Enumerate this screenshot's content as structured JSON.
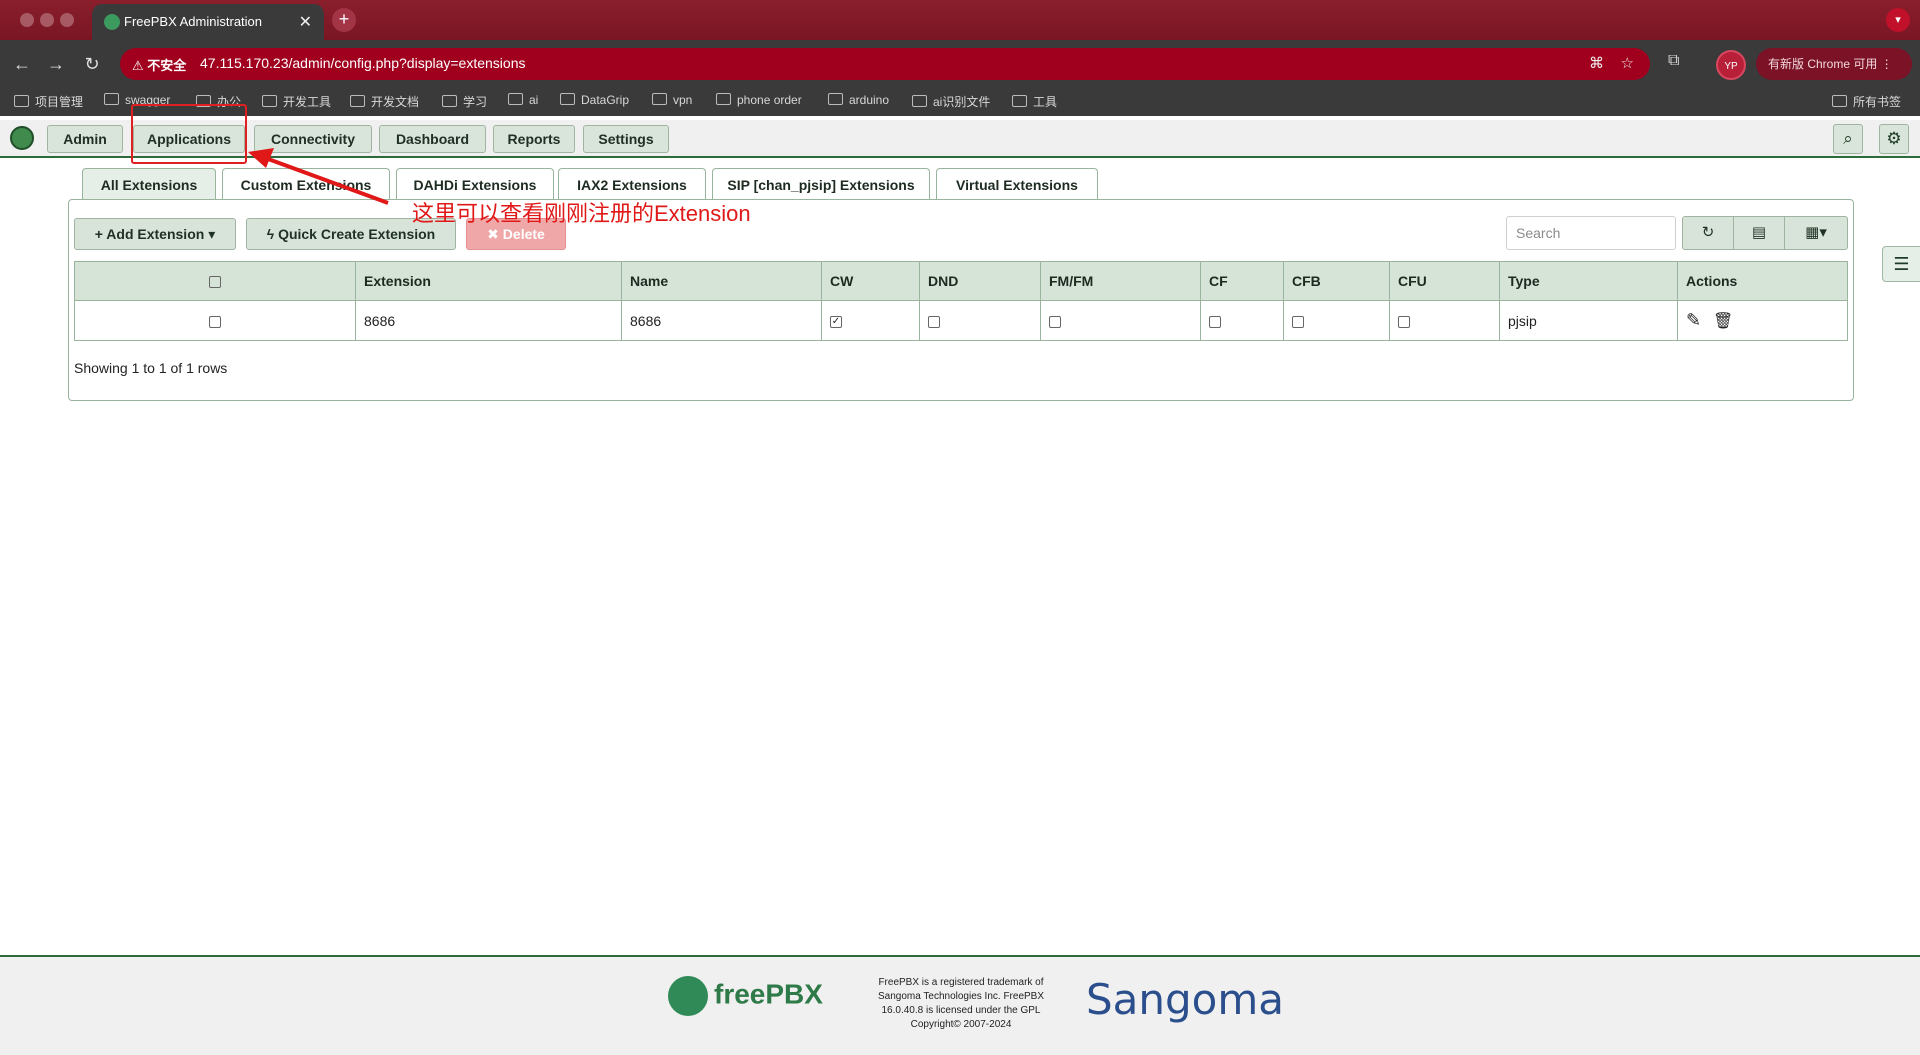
{
  "browser": {
    "tab_title": "FreePBX Administration",
    "close_glyph": "✕",
    "new_tab_glyph": "+",
    "insecure_label": "⚠ 不安全",
    "url": "47.115.170.23/admin/config.php?display=extensions",
    "profile_initials": "YP",
    "update_label": "有新版 Chrome 可用 ⋮",
    "bookmarks": [
      "项目管理",
      "swagger",
      "办公",
      "开发工具",
      "开发文档",
      "学习",
      "ai",
      "DataGrip",
      "vpn",
      "phone order",
      "arduino",
      "ai识别文件",
      "工具"
    ],
    "all_bookmarks": "所有书签"
  },
  "nav": {
    "items": [
      "Admin",
      "Applications",
      "Connectivity",
      "Dashboard",
      "Reports",
      "Settings"
    ]
  },
  "tabs": [
    "All Extensions",
    "Custom Extensions",
    "DAHDi Extensions",
    "IAX2 Extensions",
    "SIP [chan_pjsip] Extensions",
    "Virtual Extensions"
  ],
  "toolbar": {
    "add_label": "+ Add Extension ▾",
    "quick_label": "ϟ Quick Create Extension",
    "delete_label": "✖ Delete",
    "search_placeholder": "Search"
  },
  "table": {
    "headers": [
      "",
      "Extension",
      "Name",
      "CW",
      "DND",
      "FM/FM",
      "CF",
      "CFB",
      "CFU",
      "Type",
      "Actions"
    ],
    "rows": [
      {
        "extension": "8686",
        "name": "8686",
        "cw": true,
        "dnd": false,
        "fmfm": false,
        "cf": false,
        "cfb": false,
        "cfu": false,
        "type": "pjsip"
      }
    ]
  },
  "status_text": "Showing 1 to 1 of 1 rows",
  "annotation": "这里可以查看刚刚注册的Extension",
  "footer": {
    "logo_text": "freePBX",
    "legal": "FreePBX is a registered trademark of Sangoma Technologies Inc. FreePBX 16.0.40.8 is licensed under the GPL Copyright© 2007-2024",
    "brand": "Sangoma"
  },
  "colors": {
    "accent": "#2e6b3a",
    "chrome": "#a0001e",
    "annotation": "#e01818"
  }
}
